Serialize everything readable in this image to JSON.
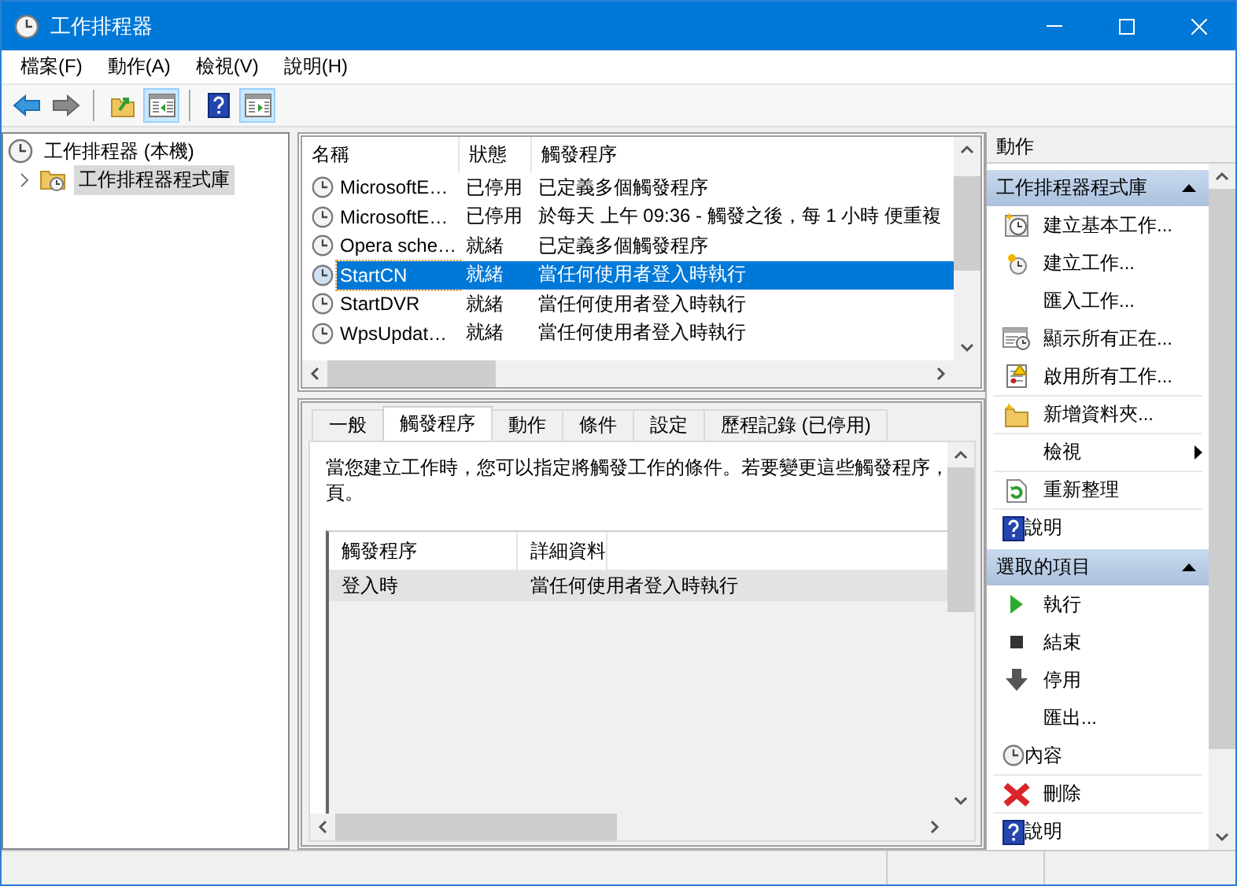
{
  "window": {
    "title": "工作排程器"
  },
  "menu": [
    "檔案(F)",
    "動作(A)",
    "檢視(V)",
    "說明(H)"
  ],
  "toolbar": [
    [
      {
        "kind": "back",
        "pressed": false
      },
      {
        "kind": "forward",
        "pressed": false
      }
    ],
    [
      {
        "kind": "up",
        "pressed": false
      },
      {
        "kind": "console-tree",
        "pressed": true
      }
    ],
    [
      {
        "kind": "help",
        "pressed": false
      },
      {
        "kind": "action-pane",
        "pressed": true
      }
    ]
  ],
  "tree": [
    {
      "label": "工作排程器 (本機)",
      "selected": false,
      "children": [
        {
          "label": "工作排程器程式庫",
          "selected": true,
          "expanded": false
        }
      ]
    }
  ],
  "task_list": {
    "columns": [
      "名稱",
      "狀態",
      "觸發程序"
    ],
    "rows": [
      {
        "name": "MicrosoftE…",
        "status": "已停用",
        "trigger": "已定義多個觸發程序",
        "selected": false
      },
      {
        "name": "MicrosoftE…",
        "status": "已停用",
        "trigger": "於每天 上午 09:36 - 觸發之後，每 1 小時 便重複",
        "selected": false
      },
      {
        "name": "Opera sche…",
        "status": "就緒",
        "trigger": "已定義多個觸發程序",
        "selected": false
      },
      {
        "name": "StartCN",
        "status": "就緒",
        "trigger": "當任何使用者登入時執行",
        "selected": true
      },
      {
        "name": "StartDVR",
        "status": "就緒",
        "trigger": "當任何使用者登入時執行",
        "selected": false
      },
      {
        "name": "WpsUpdat…",
        "status": "就緒",
        "trigger": "當任何使用者登入時執行",
        "selected": false
      }
    ]
  },
  "detail_tabs": [
    {
      "label": "一般",
      "selected": false
    },
    {
      "label": "觸發程序",
      "selected": true
    },
    {
      "label": "動作",
      "selected": false
    },
    {
      "label": "條件",
      "selected": false
    },
    {
      "label": "設定",
      "selected": false
    },
    {
      "label": "歷程記錄 (已停用)",
      "selected": false
    }
  ],
  "trigger_page": {
    "description_lines": [
      "當您建立工作時，您可以指定將觸發工作的條件。若要變更這些觸發程序，",
      "頁。"
    ],
    "columns": [
      "觸發程序",
      "詳細資料"
    ],
    "rows": [
      {
        "trigger": "登入時",
        "details": "當任何使用者登入時執行",
        "selected": true
      }
    ]
  },
  "actions": {
    "title": "動作",
    "sections": [
      {
        "title": "工作排程器程式庫",
        "expanded": true,
        "items": [
          {
            "label": "建立基本工作...",
            "kind": "task-wizard",
            "separated": false,
            "submenu": false
          },
          {
            "label": "建立工作...",
            "kind": "new-task",
            "separated": false,
            "submenu": false
          },
          {
            "label": "匯入工作...",
            "kind": "plain",
            "separated": false,
            "submenu": false
          },
          {
            "label": "顯示所有正在...",
            "kind": "calendar",
            "separated": false,
            "submenu": false
          },
          {
            "label": "啟用所有工作...",
            "kind": "log",
            "separated": false,
            "submenu": false
          },
          {
            "label": "新增資料夾...",
            "kind": "folder",
            "separated": true,
            "submenu": false
          },
          {
            "label": "檢視",
            "kind": "plain",
            "separated": true,
            "submenu": true
          },
          {
            "label": "重新整理",
            "kind": "refresh",
            "separated": true,
            "submenu": false
          },
          {
            "label": "說明",
            "kind": "help",
            "separated": true,
            "submenu": false
          }
        ]
      },
      {
        "title": "選取的項目",
        "expanded": true,
        "items": [
          {
            "label": "執行",
            "kind": "run",
            "separated": false,
            "submenu": false
          },
          {
            "label": "結束",
            "kind": "stop",
            "separated": false,
            "submenu": false
          },
          {
            "label": "停用",
            "kind": "disable",
            "separated": false,
            "submenu": false
          },
          {
            "label": "匯出...",
            "kind": "plain",
            "separated": false,
            "submenu": false
          },
          {
            "label": "內容",
            "kind": "properties",
            "separated": false,
            "submenu": false
          },
          {
            "label": "刪除",
            "kind": "delete",
            "separated": true,
            "submenu": false
          },
          {
            "label": "說明",
            "kind": "help",
            "separated": true,
            "submenu": false
          }
        ]
      }
    ]
  }
}
